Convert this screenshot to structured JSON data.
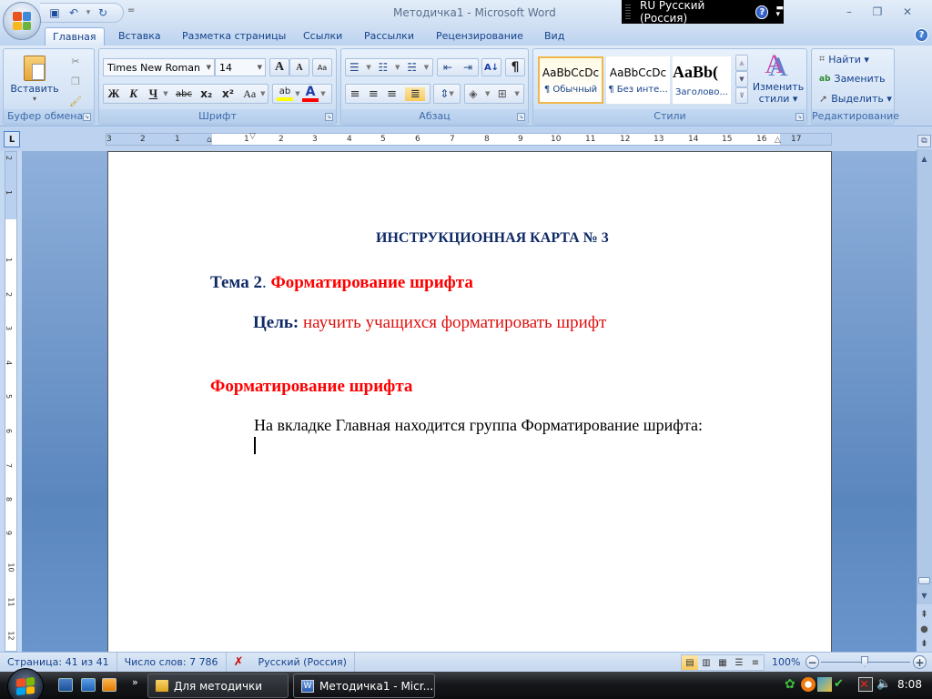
{
  "window": {
    "title": "Методичка1 - Microsoft Word",
    "minimize_label": "–",
    "maximize_label": "❐",
    "close_label": "✕"
  },
  "quick_access": {
    "save_icon": "💾",
    "undo_icon": "↶",
    "undo_dd": "▾",
    "redo_icon": "↻",
    "customize": "="
  },
  "language_bar": {
    "label": "RU Русский (Россия)",
    "help": "?",
    "options": "▬\n▾"
  },
  "tabs": [
    {
      "label": "Главная",
      "active": true
    },
    {
      "label": "Вставка"
    },
    {
      "label": "Разметка страницы"
    },
    {
      "label": "Ссылки"
    },
    {
      "label": "Рассылки"
    },
    {
      "label": "Рецензирование"
    },
    {
      "label": "Вид"
    }
  ],
  "help_icon": "?",
  "ribbon": {
    "clipboard": {
      "label": "Буфер обмена",
      "paste": "Вставить",
      "paste_dd": "▾"
    },
    "font": {
      "label": "Шрифт",
      "font_name": "Times New Roman",
      "font_size": "14",
      "grow": "A",
      "shrink": "A",
      "clear": "Aa",
      "bold": "Ж",
      "italic": "К",
      "underline": "Ч",
      "strike": "abc",
      "subscript": "x₂",
      "superscript": "x²",
      "change_case": "Aa",
      "highlight": "ab",
      "font_color": "A",
      "highlight_color": "#ffff00",
      "font_color_value": "#ff0000"
    },
    "paragraph": {
      "label": "Абзац",
      "sort": "А↓",
      "pilcrow": "¶"
    },
    "styles": {
      "label": "Стили",
      "items": [
        {
          "sample": "AaBbCcDc",
          "name": "¶ Обычный",
          "selected": true
        },
        {
          "sample": "AaBbCcDc",
          "name": "¶ Без инте..."
        },
        {
          "sample": "AaBb(",
          "name": "Заголово..."
        }
      ],
      "change_styles_line1": "Изменить",
      "change_styles_line2": "стили ▾"
    },
    "editing": {
      "label": "Редактирование",
      "find": "Найти ▾",
      "replace": "Заменить",
      "select": "Выделить ▾"
    }
  },
  "ruler": {
    "tab_selector": "L",
    "h_numbers": [
      "3",
      "2",
      "1",
      "1",
      "2",
      "3",
      "4",
      "5",
      "6",
      "7",
      "8",
      "9",
      "10",
      "11",
      "12",
      "13",
      "14",
      "15",
      "16",
      "17"
    ],
    "v_numbers": [
      "2",
      "1",
      "1",
      "2",
      "3",
      "4",
      "5",
      "6",
      "7",
      "8",
      "9",
      "10",
      "11",
      "12"
    ]
  },
  "document": {
    "heading": "ИНСТРУКЦИОННАЯ КАРТА № 3",
    "topic_label": "Тема 2",
    "topic_dot": ".",
    "topic_title": "Форматирование шрифта",
    "goal_label": "Цель:",
    "goal_text": "научить учащихся форматировать шрифт",
    "section_title": "Форматирование шрифта",
    "paragraph": "На вкладке Главная находится группа Форматирование шрифта:",
    "colors": {
      "navy": "#0f2a66",
      "red": "#ff0000",
      "dark_red": "#e01010"
    }
  },
  "statusbar": {
    "page": "Страница: 41 из 41",
    "words": "Число слов: 7 786",
    "language": "Русский (Россия)",
    "zoom": "100%",
    "zoom_minus": "−",
    "zoom_plus": "+"
  },
  "taskbar": {
    "more": "»",
    "buttons": [
      {
        "label": "Для методички"
      },
      {
        "label": "Методичка1 - Micr...",
        "active": true
      }
    ],
    "clock": "8:08"
  }
}
